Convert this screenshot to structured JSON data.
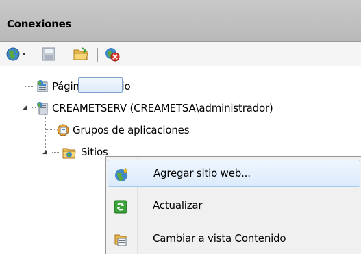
{
  "panel": {
    "title": "Conexiones"
  },
  "toolbar": {
    "icons": [
      "globe-dropdown-icon",
      "save-icon",
      "folder-icon",
      "disconnect-icon"
    ]
  },
  "tree": {
    "nodes": [
      {
        "label": "Página de inicio",
        "icon": "home-page-icon"
      },
      {
        "label": "CREAMETSERV (CREAMETSA\\administrador)",
        "icon": "server-icon"
      },
      {
        "label": "Grupos de aplicaciones",
        "icon": "app-pools-icon"
      },
      {
        "label": "Sitios",
        "icon": "sites-folder-icon"
      }
    ]
  },
  "context_menu": {
    "items": [
      {
        "label": "Agregar sitio web...",
        "icon": "add-site-icon"
      },
      {
        "label": "Actualizar",
        "icon": "refresh-icon"
      },
      {
        "label": "Cambiar a vista Contenido",
        "icon": "content-view-icon"
      }
    ]
  }
}
